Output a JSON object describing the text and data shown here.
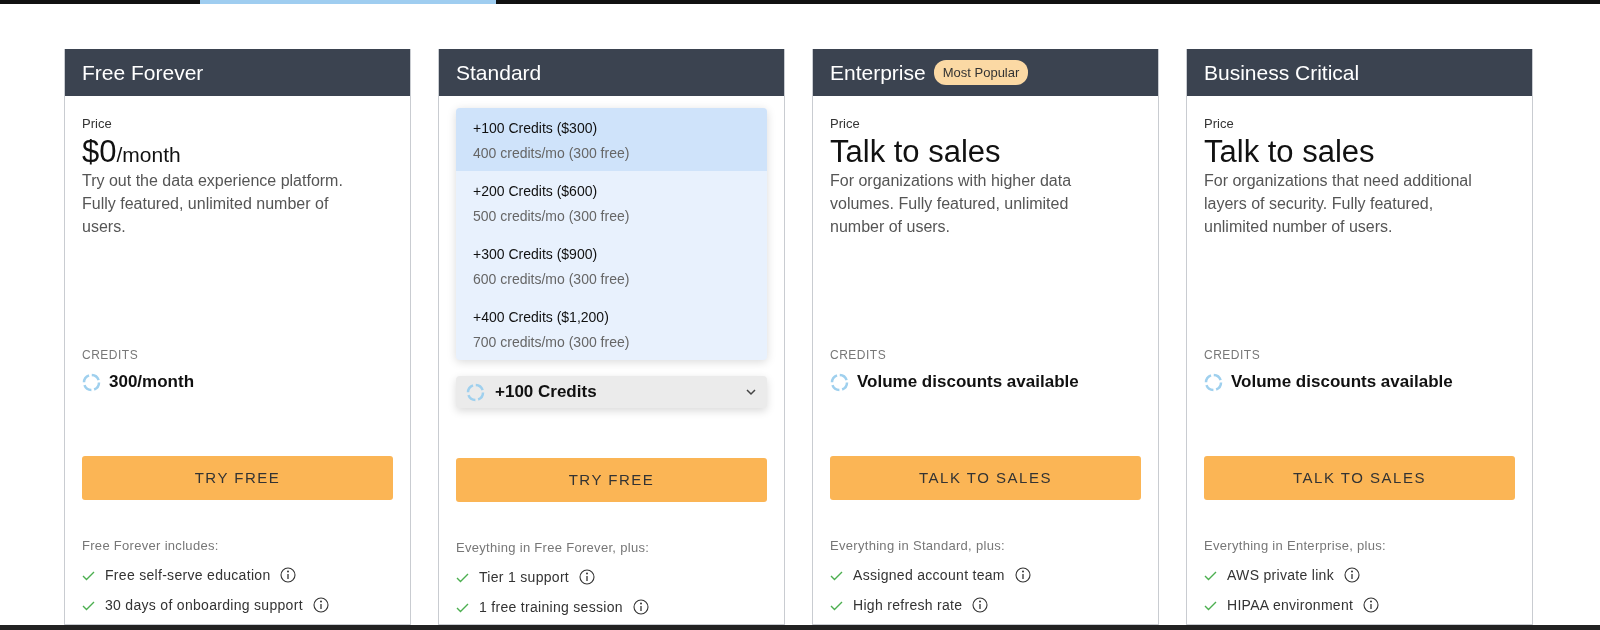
{
  "plans": [
    {
      "title": "Free Forever",
      "price_label": "Price",
      "price": {
        "amount": "$0",
        "unit": "/month"
      },
      "description": "Try out the data experience platform. Fully featured, unlimited number of users.",
      "credits_label": "CREDITS",
      "credits": "300/month",
      "button": "TRY FREE",
      "includes_heading": "Free Forever includes:",
      "features": [
        "Free self-serve education",
        "30 days of onboarding support"
      ]
    },
    {
      "title": "Standard",
      "credit_select": {
        "value": "+100 Credits",
        "expanded": true,
        "options": [
          {
            "label": "+100 Credits ($300)",
            "detail": "400 credits/mo (300 free)",
            "selected": true
          },
          {
            "label": "+200 Credits ($600)",
            "detail": "500 credits/mo (300 free)",
            "selected": false
          },
          {
            "label": "+300 Credits ($900)",
            "detail": "600 credits/mo (300 free)",
            "selected": false
          },
          {
            "label": "+400 Credits ($1,200)",
            "detail": "700 credits/mo (300 free)",
            "selected": false
          }
        ]
      },
      "button": "TRY FREE",
      "includes_heading": "Eveything in Free Forever, plus:",
      "features": [
        "Tier 1 support",
        "1 free training session"
      ]
    },
    {
      "title": "Enterprise",
      "badge": "Most Popular",
      "price_label": "Price",
      "price": {
        "amount": "Talk to sales"
      },
      "description": "For organizations with higher data volumes. Fully featured, unlimited number of users.",
      "credits_label": "CREDITS",
      "credits": "Volume discounts available",
      "button": "TALK TO SALES",
      "includes_heading": "Everything in Standard, plus:",
      "features": [
        "Assigned account team",
        "High refresh rate"
      ]
    },
    {
      "title": "Business Critical",
      "price_label": "Price",
      "price": {
        "amount": "Talk to sales"
      },
      "description": "For organizations that need additional layers of security. Fully featured, unlimited number of users.",
      "credits_label": "CREDITS",
      "credits": "Volume discounts available",
      "button": "TALK TO SALES",
      "includes_heading": "Everything in Enterprise, plus:",
      "features": [
        "AWS private link",
        "HIPAA environment"
      ]
    }
  ]
}
